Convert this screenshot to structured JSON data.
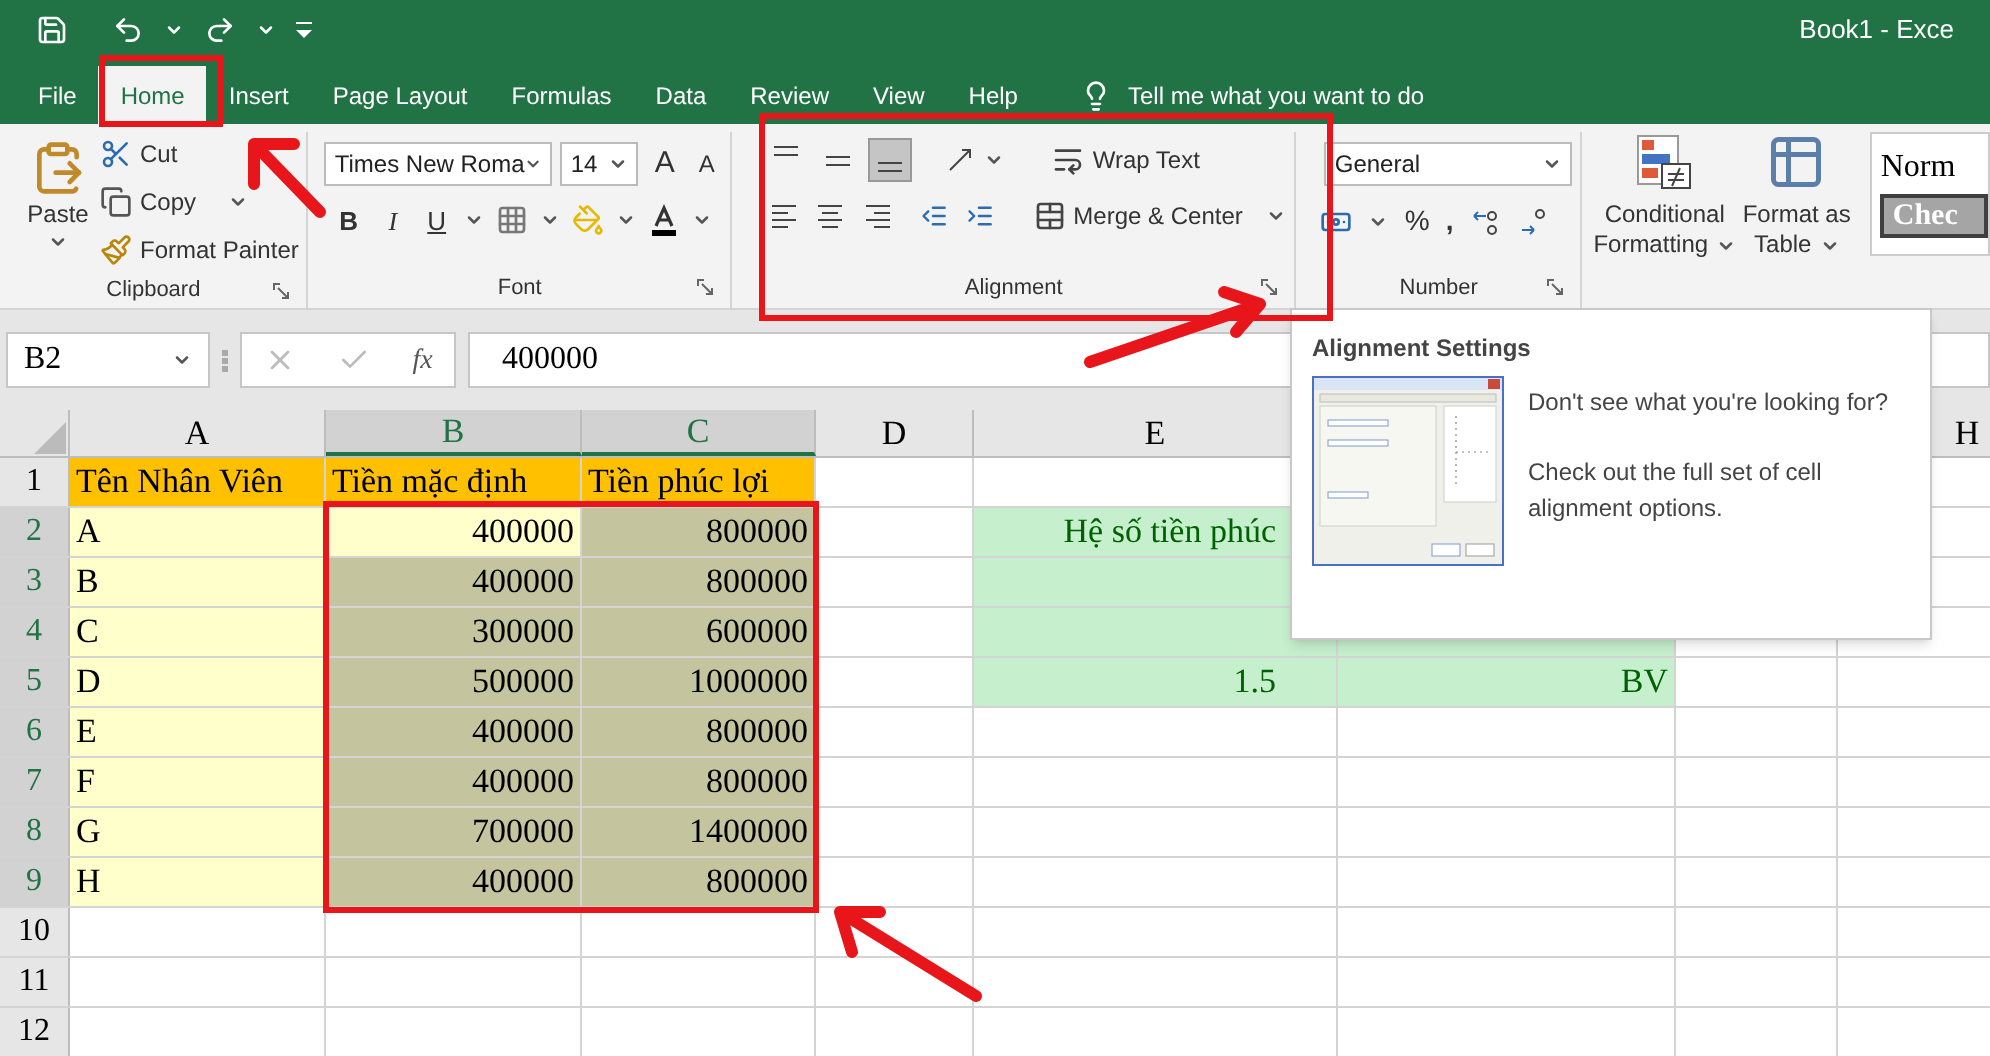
{
  "title_bar": {
    "title": "Book1 - Exce"
  },
  "tabs": [
    {
      "label": "File",
      "selected": false
    },
    {
      "label": "Home",
      "selected": true
    },
    {
      "label": "Insert",
      "selected": false
    },
    {
      "label": "Page Layout",
      "selected": false
    },
    {
      "label": "Formulas",
      "selected": false
    },
    {
      "label": "Data",
      "selected": false
    },
    {
      "label": "Review",
      "selected": false
    },
    {
      "label": "View",
      "selected": false
    },
    {
      "label": "Help",
      "selected": false
    }
  ],
  "tell_me": {
    "placeholder": "Tell me what you want to do"
  },
  "ribbon": {
    "clipboard": {
      "label": "Clipboard",
      "paste": "Paste",
      "cut": "Cut",
      "copy": "Copy",
      "format_painter": "Format Painter"
    },
    "font": {
      "label": "Font",
      "font_name": "Times New Roma",
      "font_size": "14",
      "grow": "A",
      "shrink": "A",
      "bold": "B",
      "italic": "I",
      "underline": "U"
    },
    "alignment": {
      "label": "Alignment",
      "vertical": [
        {
          "kind": "top",
          "selected": false
        },
        {
          "kind": "middle",
          "selected": false
        },
        {
          "kind": "bottom",
          "selected": true
        }
      ],
      "horizontal": [
        {
          "kind": "left",
          "selected": false
        },
        {
          "kind": "center",
          "selected": false
        },
        {
          "kind": "right",
          "selected": false
        }
      ],
      "wrap_text": "Wrap Text",
      "merge": "Merge & Center"
    },
    "number": {
      "label": "Number",
      "format": "General",
      "percent": "%",
      "comma": ","
    },
    "styles": {
      "conditional": [
        "Conditional",
        "Formatting"
      ],
      "format_table": [
        "Format as",
        "Table"
      ],
      "normal": "Norm",
      "check": "Chec"
    }
  },
  "formula_bar": {
    "name_box": "B2",
    "function_label": "fx",
    "value": "400000"
  },
  "sheet": {
    "columns": [
      {
        "label": "A",
        "selected": false
      },
      {
        "label": "B",
        "selected": true
      },
      {
        "label": "C",
        "selected": true
      },
      {
        "label": "D",
        "selected": false
      },
      {
        "label": "E",
        "selected": false
      },
      {
        "label": "H",
        "selected": false
      }
    ],
    "rows": [
      {
        "number": "1",
        "selected": false,
        "cells": [
          {
            "kind": "header",
            "text": "Tên Nhân Viên"
          },
          {
            "kind": "header",
            "text": "Tiền mặc định"
          },
          {
            "kind": "header",
            "text": "Tiền phúc lợi"
          },
          {
            "kind": "blank"
          },
          {
            "kind": "blank"
          },
          {
            "kind": "blank"
          },
          {
            "kind": "blank"
          },
          {
            "kind": "blank"
          }
        ]
      },
      {
        "number": "2",
        "selected": true,
        "cells": [
          {
            "kind": "name",
            "text": "A"
          },
          {
            "kind": "active",
            "text": "400000"
          },
          {
            "kind": "selected",
            "text": "800000"
          },
          {
            "kind": "blank"
          },
          {
            "kind": "note",
            "text": "Hệ số tiền phúc"
          },
          {
            "kind": "blank"
          },
          {
            "kind": "blank"
          },
          {
            "kind": "blank"
          }
        ]
      },
      {
        "number": "3",
        "selected": true,
        "cells": [
          {
            "kind": "name",
            "text": "B"
          },
          {
            "kind": "selected",
            "text": "400000"
          },
          {
            "kind": "selected",
            "text": "800000"
          },
          {
            "kind": "blank"
          },
          {
            "kind": "note"
          },
          {
            "kind": "blank"
          },
          {
            "kind": "blank"
          },
          {
            "kind": "blank"
          }
        ]
      },
      {
        "number": "4",
        "selected": true,
        "cells": [
          {
            "kind": "name",
            "text": "C"
          },
          {
            "kind": "selected",
            "text": "300000"
          },
          {
            "kind": "selected",
            "text": "600000"
          },
          {
            "kind": "blank"
          },
          {
            "kind": "note"
          },
          {
            "kind": "note"
          },
          {
            "kind": "blank"
          },
          {
            "kind": "blank"
          }
        ]
      },
      {
        "number": "5",
        "selected": true,
        "cells": [
          {
            "kind": "name",
            "text": "D"
          },
          {
            "kind": "selected",
            "text": "500000"
          },
          {
            "kind": "selected",
            "text": "1000000"
          },
          {
            "kind": "blank"
          },
          {
            "kind": "note",
            "text": "1.5"
          },
          {
            "kind": "note",
            "text": "BV"
          },
          {
            "kind": "blank"
          },
          {
            "kind": "blank"
          }
        ]
      },
      {
        "number": "6",
        "selected": true,
        "cells": [
          {
            "kind": "name",
            "text": "E"
          },
          {
            "kind": "selected",
            "text": "400000"
          },
          {
            "kind": "selected",
            "text": "800000"
          },
          {
            "kind": "blank"
          },
          {
            "kind": "blank"
          },
          {
            "kind": "blank"
          },
          {
            "kind": "blank"
          },
          {
            "kind": "blank"
          }
        ]
      },
      {
        "number": "7",
        "selected": true,
        "cells": [
          {
            "kind": "name",
            "text": "F"
          },
          {
            "kind": "selected",
            "text": "400000"
          },
          {
            "kind": "selected",
            "text": "800000"
          },
          {
            "kind": "blank"
          },
          {
            "kind": "blank"
          },
          {
            "kind": "blank"
          },
          {
            "kind": "blank"
          },
          {
            "kind": "blank"
          }
        ]
      },
      {
        "number": "8",
        "selected": true,
        "cells": [
          {
            "kind": "name",
            "text": "G"
          },
          {
            "kind": "selected",
            "text": "700000"
          },
          {
            "kind": "selected",
            "text": "1400000"
          },
          {
            "kind": "blank"
          },
          {
            "kind": "blank"
          },
          {
            "kind": "blank"
          },
          {
            "kind": "blank"
          },
          {
            "kind": "blank"
          }
        ]
      },
      {
        "number": "9",
        "selected": true,
        "cells": [
          {
            "kind": "name",
            "text": "H"
          },
          {
            "kind": "selected",
            "text": "400000"
          },
          {
            "kind": "selected",
            "text": "800000"
          },
          {
            "kind": "blank"
          },
          {
            "kind": "blank"
          },
          {
            "kind": "blank"
          },
          {
            "kind": "blank"
          },
          {
            "kind": "blank"
          }
        ]
      },
      {
        "number": "10",
        "selected": false,
        "cells": [
          {
            "kind": "blank"
          },
          {
            "kind": "blank"
          },
          {
            "kind": "blank"
          },
          {
            "kind": "blank"
          },
          {
            "kind": "blank"
          },
          {
            "kind": "blank"
          },
          {
            "kind": "blank"
          },
          {
            "kind": "blank"
          }
        ]
      },
      {
        "number": "11",
        "selected": false,
        "cells": [
          {
            "kind": "blank"
          },
          {
            "kind": "blank"
          },
          {
            "kind": "blank"
          },
          {
            "kind": "blank"
          },
          {
            "kind": "blank"
          },
          {
            "kind": "blank"
          },
          {
            "kind": "blank"
          },
          {
            "kind": "blank"
          }
        ]
      },
      {
        "number": "12",
        "selected": false,
        "cells": [
          {
            "kind": "blank"
          },
          {
            "kind": "blank"
          },
          {
            "kind": "blank"
          },
          {
            "kind": "blank"
          },
          {
            "kind": "blank"
          },
          {
            "kind": "blank"
          },
          {
            "kind": "blank"
          },
          {
            "kind": "blank"
          }
        ]
      }
    ]
  },
  "tooltip": {
    "title": "Alignment Settings",
    "question": "Don't see what you're looking for?",
    "description": "Check out the full set of cell alignment options."
  }
}
